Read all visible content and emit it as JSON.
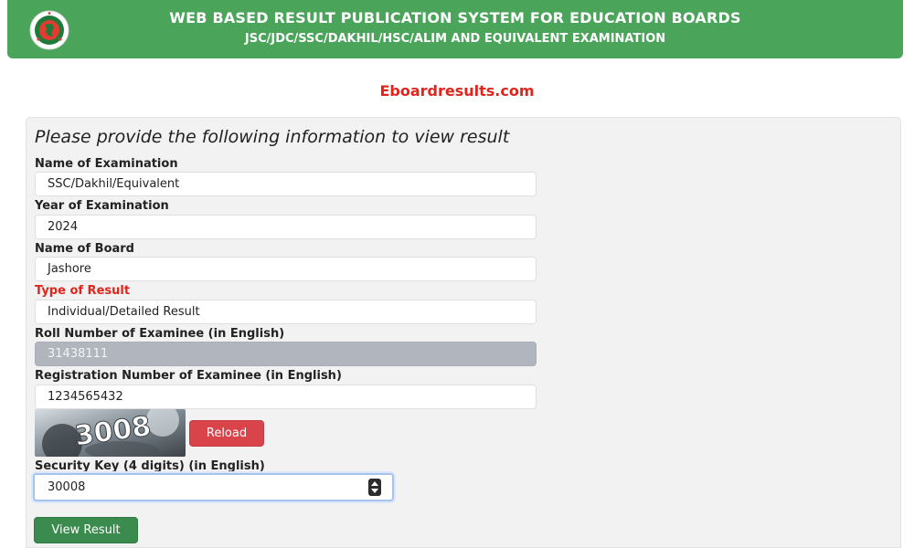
{
  "header": {
    "title": "WEB BASED RESULT PUBLICATION SYSTEM FOR EDUCATION BOARDS",
    "subtitle": "JSC/JDC/SSC/DAKHIL/HSC/ALIM AND EQUIVALENT EXAMINATION",
    "logo_icon": "government-seal-icon"
  },
  "site_name": "Eboardresults.com",
  "form": {
    "prompt": "Please provide the following information to view result",
    "exam_label": "Name of Examination",
    "exam_value": "SSC/Dakhil/Equivalent",
    "year_label": "Year of Examination",
    "year_value": "2024",
    "board_label": "Name of Board",
    "board_value": "Jashore",
    "result_type_label": "Type of Result",
    "result_type_value": "Individual/Detailed Result",
    "roll_label": "Roll Number of Examinee (in English)",
    "roll_value": "31438111",
    "reg_label": "Registration Number of Examinee (in English)",
    "reg_value": "1234565432",
    "captcha_text": "3008",
    "reload_label": "Reload",
    "security_label": "Security Key (4 digits) (in English)",
    "security_value": "30008",
    "submit_label": "View Result"
  },
  "colors": {
    "header_green": "#4aa55a",
    "accent_red": "#e0261c",
    "reload_red": "#d9444b",
    "submit_green": "#3b8a4e"
  }
}
